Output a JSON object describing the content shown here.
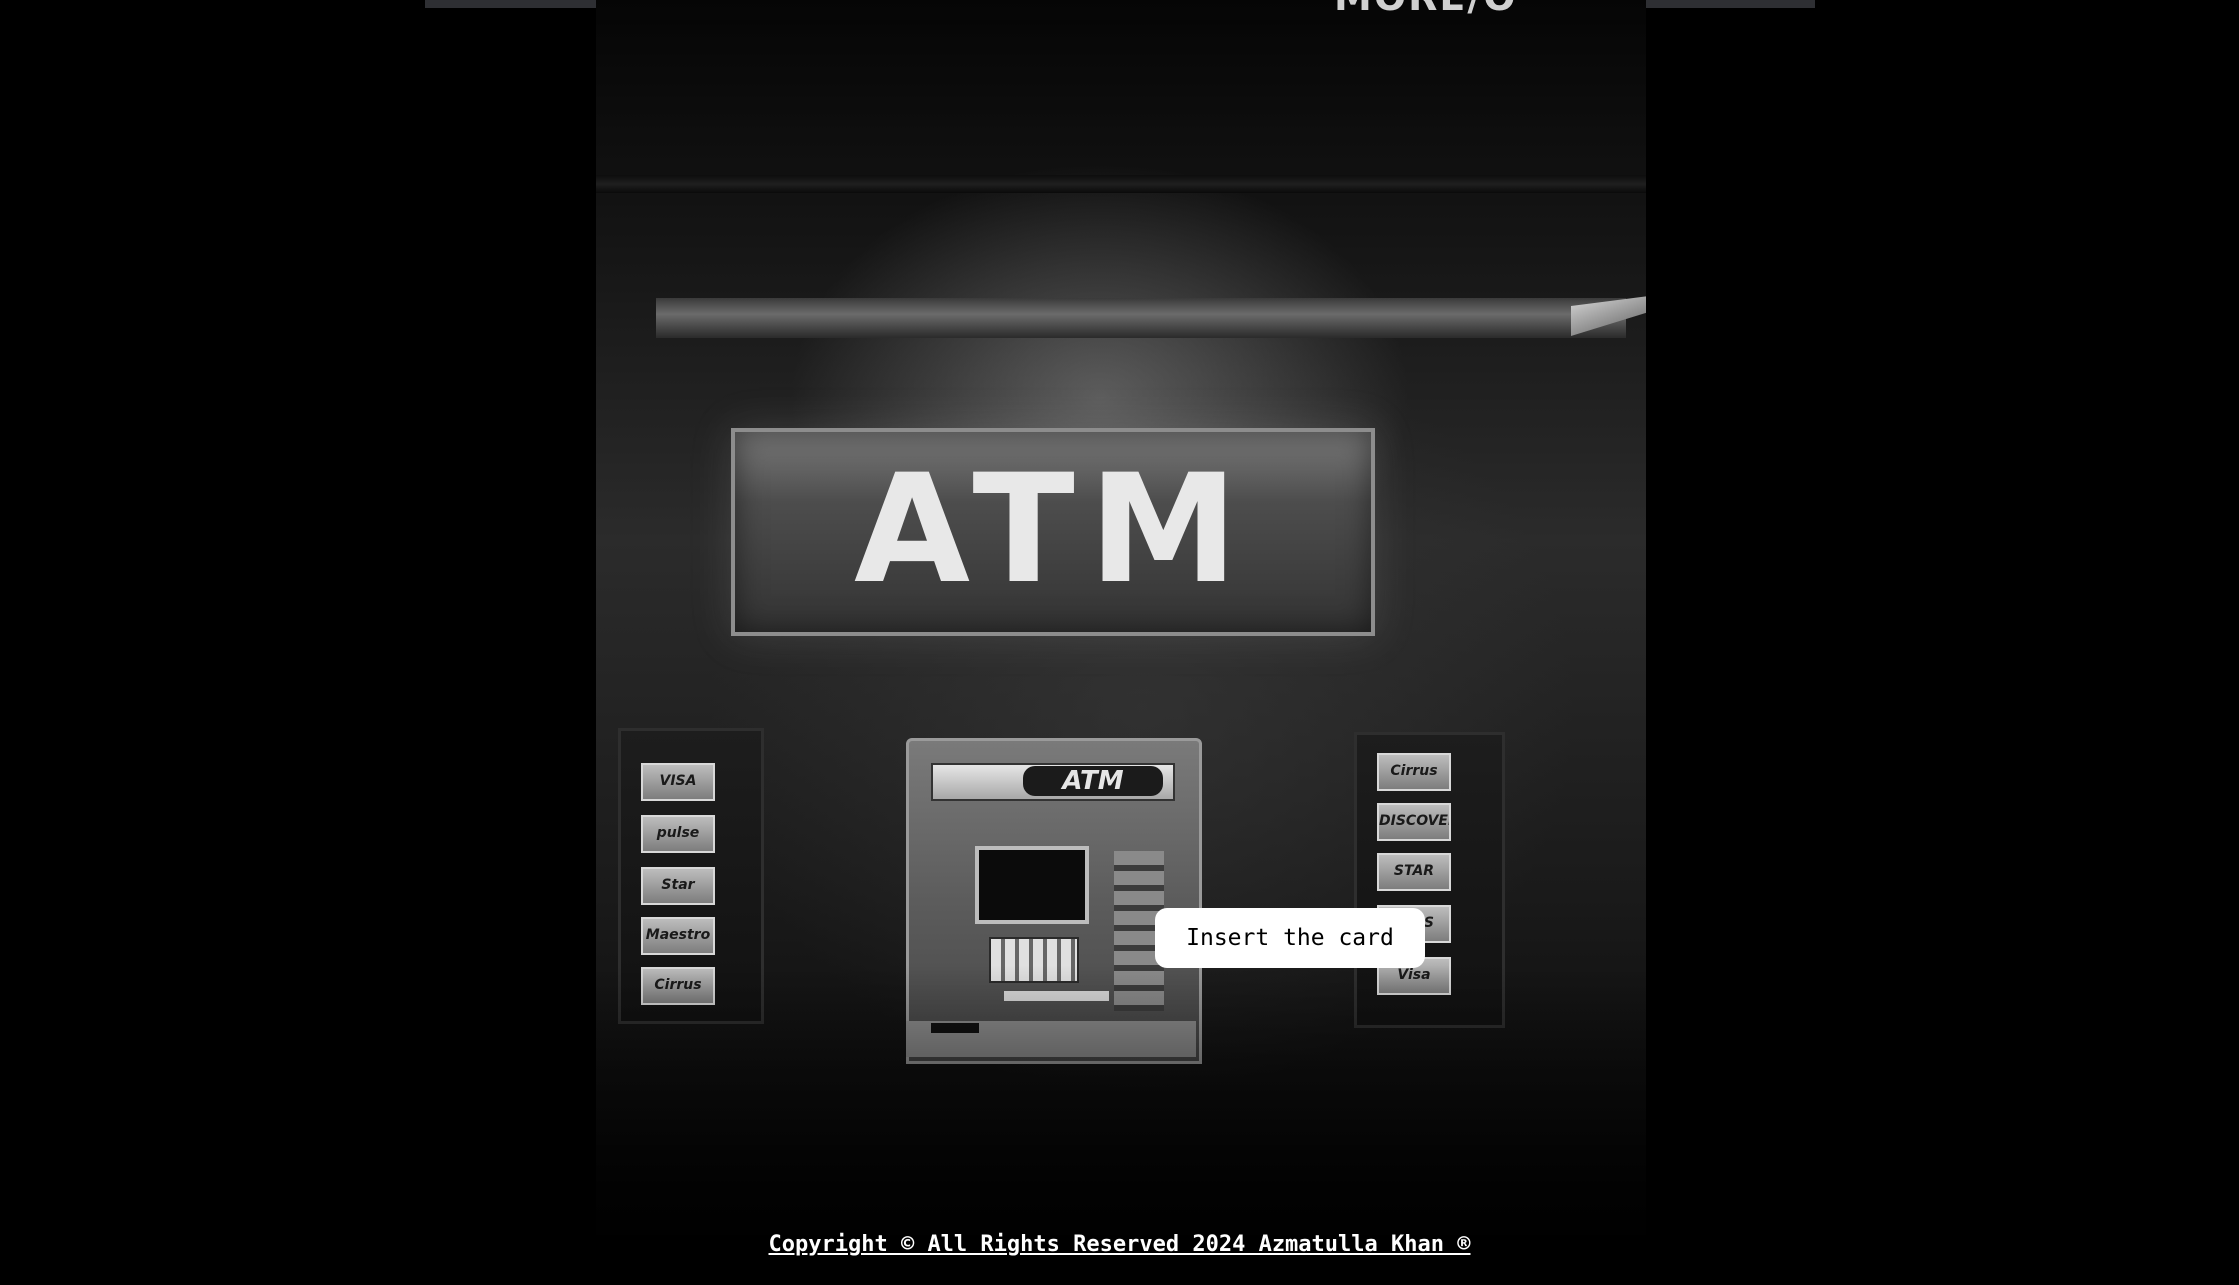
{
  "background_photo": {
    "top_partial_text": "MORE/O",
    "sign_text": "ATM",
    "machine_header_text": "ATM",
    "card_logos_left": [
      "VISA",
      "pulse",
      "Star",
      "Maestro",
      "Cirrus"
    ],
    "card_logos_right": [
      "Cirrus",
      "DISCOVER",
      "STAR",
      "PLUS",
      "Visa"
    ]
  },
  "action": {
    "insert_card_label": "Insert the card"
  },
  "footer": {
    "copyright_text": "Copyright © All Rights Reserved 2024 Azmatulla Khan ®"
  },
  "colors": {
    "page_background": "#000000",
    "button_background": "#ffffff",
    "footer_text": "#ffffff"
  }
}
